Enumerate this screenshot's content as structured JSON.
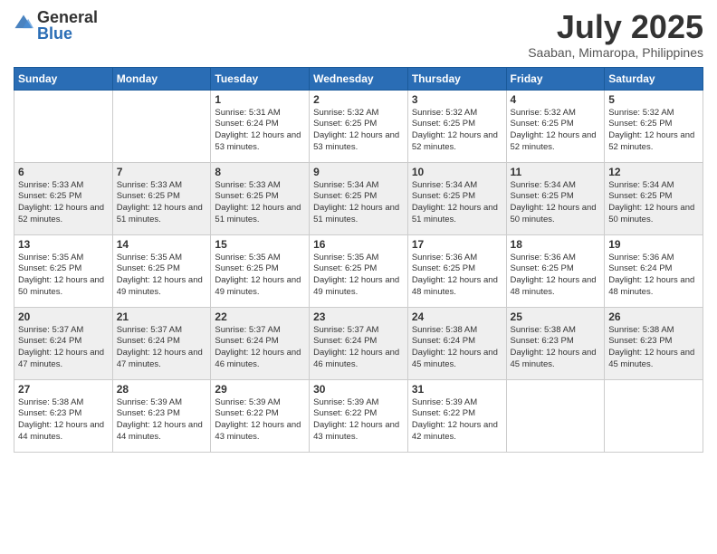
{
  "header": {
    "logo_general": "General",
    "logo_blue": "Blue",
    "title": "July 2025",
    "subtitle": "Saaban, Mimaropa, Philippines"
  },
  "days_of_week": [
    "Sunday",
    "Monday",
    "Tuesday",
    "Wednesday",
    "Thursday",
    "Friday",
    "Saturday"
  ],
  "weeks": [
    {
      "row_class": "row-odd",
      "days": [
        {
          "number": "",
          "info": "",
          "empty": true
        },
        {
          "number": "",
          "info": "",
          "empty": true
        },
        {
          "number": "1",
          "info": "Sunrise: 5:31 AM\nSunset: 6:24 PM\nDaylight: 12 hours and 53 minutes."
        },
        {
          "number": "2",
          "info": "Sunrise: 5:32 AM\nSunset: 6:25 PM\nDaylight: 12 hours and 53 minutes."
        },
        {
          "number": "3",
          "info": "Sunrise: 5:32 AM\nSunset: 6:25 PM\nDaylight: 12 hours and 52 minutes."
        },
        {
          "number": "4",
          "info": "Sunrise: 5:32 AM\nSunset: 6:25 PM\nDaylight: 12 hours and 52 minutes."
        },
        {
          "number": "5",
          "info": "Sunrise: 5:32 AM\nSunset: 6:25 PM\nDaylight: 12 hours and 52 minutes."
        }
      ]
    },
    {
      "row_class": "row-even",
      "days": [
        {
          "number": "6",
          "info": "Sunrise: 5:33 AM\nSunset: 6:25 PM\nDaylight: 12 hours and 52 minutes."
        },
        {
          "number": "7",
          "info": "Sunrise: 5:33 AM\nSunset: 6:25 PM\nDaylight: 12 hours and 51 minutes."
        },
        {
          "number": "8",
          "info": "Sunrise: 5:33 AM\nSunset: 6:25 PM\nDaylight: 12 hours and 51 minutes."
        },
        {
          "number": "9",
          "info": "Sunrise: 5:34 AM\nSunset: 6:25 PM\nDaylight: 12 hours and 51 minutes."
        },
        {
          "number": "10",
          "info": "Sunrise: 5:34 AM\nSunset: 6:25 PM\nDaylight: 12 hours and 51 minutes."
        },
        {
          "number": "11",
          "info": "Sunrise: 5:34 AM\nSunset: 6:25 PM\nDaylight: 12 hours and 50 minutes."
        },
        {
          "number": "12",
          "info": "Sunrise: 5:34 AM\nSunset: 6:25 PM\nDaylight: 12 hours and 50 minutes."
        }
      ]
    },
    {
      "row_class": "row-odd",
      "days": [
        {
          "number": "13",
          "info": "Sunrise: 5:35 AM\nSunset: 6:25 PM\nDaylight: 12 hours and 50 minutes."
        },
        {
          "number": "14",
          "info": "Sunrise: 5:35 AM\nSunset: 6:25 PM\nDaylight: 12 hours and 49 minutes."
        },
        {
          "number": "15",
          "info": "Sunrise: 5:35 AM\nSunset: 6:25 PM\nDaylight: 12 hours and 49 minutes."
        },
        {
          "number": "16",
          "info": "Sunrise: 5:35 AM\nSunset: 6:25 PM\nDaylight: 12 hours and 49 minutes."
        },
        {
          "number": "17",
          "info": "Sunrise: 5:36 AM\nSunset: 6:25 PM\nDaylight: 12 hours and 48 minutes."
        },
        {
          "number": "18",
          "info": "Sunrise: 5:36 AM\nSunset: 6:25 PM\nDaylight: 12 hours and 48 minutes."
        },
        {
          "number": "19",
          "info": "Sunrise: 5:36 AM\nSunset: 6:24 PM\nDaylight: 12 hours and 48 minutes."
        }
      ]
    },
    {
      "row_class": "row-even",
      "days": [
        {
          "number": "20",
          "info": "Sunrise: 5:37 AM\nSunset: 6:24 PM\nDaylight: 12 hours and 47 minutes."
        },
        {
          "number": "21",
          "info": "Sunrise: 5:37 AM\nSunset: 6:24 PM\nDaylight: 12 hours and 47 minutes."
        },
        {
          "number": "22",
          "info": "Sunrise: 5:37 AM\nSunset: 6:24 PM\nDaylight: 12 hours and 46 minutes."
        },
        {
          "number": "23",
          "info": "Sunrise: 5:37 AM\nSunset: 6:24 PM\nDaylight: 12 hours and 46 minutes."
        },
        {
          "number": "24",
          "info": "Sunrise: 5:38 AM\nSunset: 6:24 PM\nDaylight: 12 hours and 45 minutes."
        },
        {
          "number": "25",
          "info": "Sunrise: 5:38 AM\nSunset: 6:23 PM\nDaylight: 12 hours and 45 minutes."
        },
        {
          "number": "26",
          "info": "Sunrise: 5:38 AM\nSunset: 6:23 PM\nDaylight: 12 hours and 45 minutes."
        }
      ]
    },
    {
      "row_class": "row-odd",
      "days": [
        {
          "number": "27",
          "info": "Sunrise: 5:38 AM\nSunset: 6:23 PM\nDaylight: 12 hours and 44 minutes."
        },
        {
          "number": "28",
          "info": "Sunrise: 5:39 AM\nSunset: 6:23 PM\nDaylight: 12 hours and 44 minutes."
        },
        {
          "number": "29",
          "info": "Sunrise: 5:39 AM\nSunset: 6:22 PM\nDaylight: 12 hours and 43 minutes."
        },
        {
          "number": "30",
          "info": "Sunrise: 5:39 AM\nSunset: 6:22 PM\nDaylight: 12 hours and 43 minutes."
        },
        {
          "number": "31",
          "info": "Sunrise: 5:39 AM\nSunset: 6:22 PM\nDaylight: 12 hours and 42 minutes."
        },
        {
          "number": "",
          "info": "",
          "empty": true
        },
        {
          "number": "",
          "info": "",
          "empty": true
        }
      ]
    }
  ]
}
